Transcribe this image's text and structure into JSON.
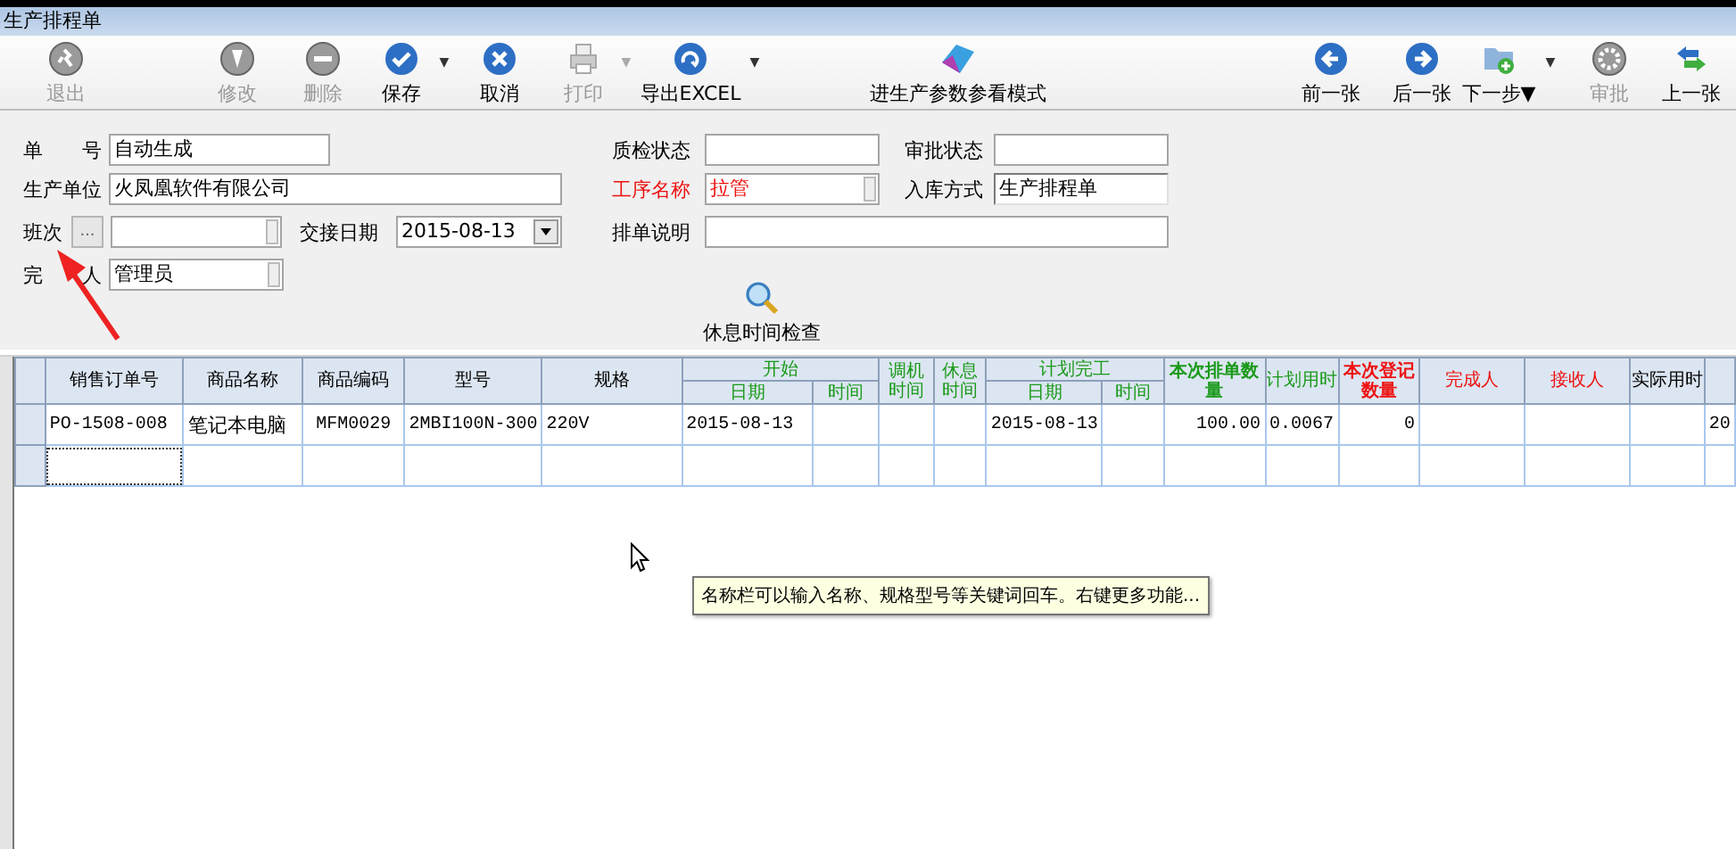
{
  "window": {
    "title": "生产排程单"
  },
  "toolbar": [
    {
      "kind": "exit",
      "label": "退出",
      "disabled": true
    },
    {
      "kind": "edit",
      "label": "修改",
      "disabled": true
    },
    {
      "kind": "delete",
      "label": "删除",
      "disabled": true
    },
    {
      "kind": "save",
      "label": "保存",
      "disabled": false,
      "dropdown": "▼"
    },
    {
      "kind": "cancel",
      "label": "取消",
      "disabled": false
    },
    {
      "kind": "print",
      "label": "打印",
      "disabled": true,
      "dropdown": "▼"
    },
    {
      "kind": "export",
      "label": "导出EXCEL",
      "disabled": false,
      "dropdown": "▼"
    },
    {
      "kind": "mode",
      "label": "进生产参数参看模式",
      "disabled": false
    },
    {
      "kind": "prev",
      "label": "前一张",
      "disabled": false
    },
    {
      "kind": "next",
      "label": "后一张",
      "disabled": false
    },
    {
      "kind": "step",
      "label": "下一步▼",
      "disabled": false,
      "dropdown": "▼"
    },
    {
      "kind": "approve",
      "label": "审批",
      "disabled": true
    },
    {
      "kind": "up",
      "label": "上一张",
      "disabled": false
    }
  ],
  "form": {
    "fields": [
      {
        "kind": "text",
        "label": "单　　号",
        "value": "自动生成",
        "required": false
      },
      {
        "kind": "text",
        "label": "质检状态",
        "required": false
      },
      {
        "kind": "text",
        "label": "审批状态",
        "required": false
      },
      {
        "kind": "text",
        "label": "生产单位",
        "value": "火凤凰软件有限公司",
        "required": false
      },
      {
        "kind": "combo",
        "label": "工序名称",
        "value": "拉管",
        "required": true
      },
      {
        "kind": "readonly",
        "label": "入库方式",
        "value": "生产排程单",
        "required": false
      },
      {
        "kind": "picker",
        "label": "班次",
        "button": "...",
        "required": false
      },
      {
        "kind": "date",
        "label": "交接日期",
        "value": "2015-08-13",
        "required": false
      },
      {
        "kind": "text",
        "label": "排单说明",
        "required": false
      },
      {
        "kind": "combo",
        "label": "完　　人",
        "value": "管理员",
        "required": false
      }
    ],
    "check_button": "休息时间检查"
  },
  "table": {
    "groups": [
      {
        "label": "开始",
        "color": "#1a9a1a"
      },
      {
        "label": "计划完工",
        "color": "#1a9a1a"
      }
    ],
    "columns": [
      {
        "label": "销售订单号",
        "color": "#000000",
        "bold": false
      },
      {
        "label": "商品名称",
        "color": "#000000",
        "bold": false
      },
      {
        "label": "商品编码",
        "color": "#000000",
        "bold": false
      },
      {
        "label": "型号",
        "color": "#000000",
        "bold": false
      },
      {
        "label": "规格",
        "color": "#000000",
        "bold": false
      },
      {
        "label": "日期",
        "color": "#1a9a1a",
        "bold": false,
        "kind": "grouped"
      },
      {
        "label": "时间",
        "color": "#1a9a1a",
        "bold": false,
        "kind": "grouped"
      },
      {
        "label": "调机时间",
        "color": "#1a9a1a",
        "bold": false
      },
      {
        "label": "休息时间",
        "color": "#1a9a1a",
        "bold": false
      },
      {
        "label": "日期",
        "color": "#1a9a1a",
        "bold": false,
        "kind": "grouped"
      },
      {
        "label": "时间",
        "color": "#1a9a1a",
        "bold": false,
        "kind": "grouped"
      },
      {
        "label": "本次排单数量",
        "color": "#1a9a1a",
        "bold": true
      },
      {
        "label": "计划用时",
        "color": "#1a9a1a",
        "bold": false
      },
      {
        "label": "本次登记数量",
        "color": "#ee1111",
        "bold": true
      },
      {
        "label": "完成人",
        "color": "#ee1111",
        "bold": false
      },
      {
        "label": "接收人",
        "color": "#ee1111",
        "bold": false
      },
      {
        "label": "实际用时",
        "color": "#000000",
        "bold": false
      },
      {}
    ],
    "rows": [
      {
        "focused": false,
        "cells": [
          "PO-1508-008",
          "笔记本电脑",
          "MFM0029",
          "2MBI100N-300",
          "220V",
          "2015-08-13",
          "",
          "",
          "",
          "2015-08-13",
          "",
          "100.00",
          "0.0067",
          "0",
          "",
          "",
          "",
          "20"
        ]
      },
      {
        "focused": true,
        "cells": [
          "",
          "",
          "",
          "",
          "",
          "",
          "",
          "",
          "",
          "",
          "",
          "",
          "",
          "",
          "",
          "",
          "",
          ""
        ]
      }
    ]
  },
  "tooltip": "名称栏可以输入名称、规格型号等关键词回车。右键更多功能..."
}
